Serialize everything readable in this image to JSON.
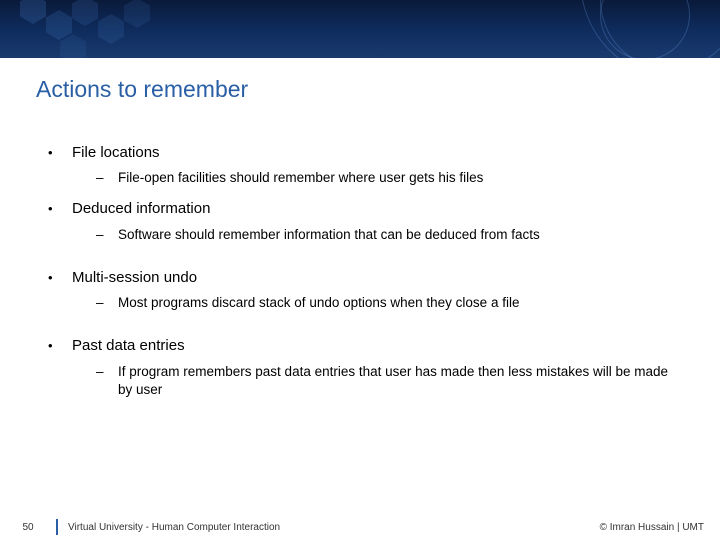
{
  "title": "Actions to remember",
  "bullets": [
    {
      "label": "File locations",
      "sub": [
        "File-open facilities should remember where user gets his files"
      ],
      "gap": false
    },
    {
      "label": "Deduced information",
      "sub": [
        "Software should remember information that can be deduced from facts"
      ],
      "gap": false
    },
    {
      "label": "Multi-session undo",
      "sub": [
        "Most programs discard stack of undo options when they close a file"
      ],
      "gap": true
    },
    {
      "label": "Past data entries",
      "sub": [
        "If program remembers past data entries that user has made then less mistakes will be made by user"
      ],
      "gap": true
    }
  ],
  "footer": {
    "page": "50",
    "center": "Virtual University - Human Computer Interaction",
    "right": "© Imran Hussain | UMT"
  }
}
